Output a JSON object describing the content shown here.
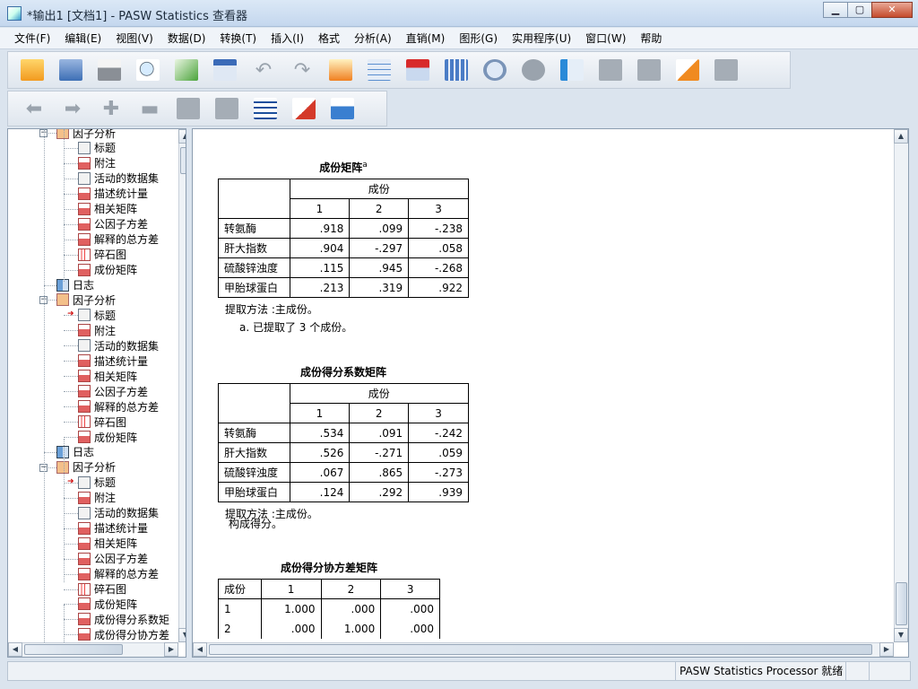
{
  "window": {
    "title": "*输出1 [文档1] - PASW Statistics 查看器",
    "minimize_label": "▁",
    "maximize_label": "▢",
    "close_label": "✕"
  },
  "menu": [
    "文件(F)",
    "编辑(E)",
    "视图(V)",
    "数据(D)",
    "转换(T)",
    "插入(I)",
    "格式",
    "分析(A)",
    "直销(M)",
    "图形(G)",
    "实用程序(U)",
    "窗口(W)",
    "帮助"
  ],
  "outline": {
    "nodes": [
      {
        "label": "因子分析",
        "indent": 1,
        "icon": "folder"
      },
      {
        "label": "标题",
        "indent": 2,
        "icon": "doc"
      },
      {
        "label": "附注",
        "indent": 2,
        "icon": "red"
      },
      {
        "label": "活动的数据集",
        "indent": 2,
        "icon": "doc"
      },
      {
        "label": "描述统计量",
        "indent": 2,
        "icon": "red"
      },
      {
        "label": "相关矩阵",
        "indent": 2,
        "icon": "red"
      },
      {
        "label": "公因子方差",
        "indent": 2,
        "icon": "red"
      },
      {
        "label": "解释的总方差",
        "indent": 2,
        "icon": "red"
      },
      {
        "label": "碎石图",
        "indent": 2,
        "icon": "chart"
      },
      {
        "label": "成份矩阵",
        "indent": 2,
        "icon": "red"
      },
      {
        "label": "日志",
        "indent": 1,
        "icon": "book"
      },
      {
        "label": "因子分析",
        "indent": 1,
        "icon": "folder"
      },
      {
        "label": "标题",
        "indent": 2,
        "icon": "doc",
        "arrow": true
      },
      {
        "label": "附注",
        "indent": 2,
        "icon": "red"
      },
      {
        "label": "活动的数据集",
        "indent": 2,
        "icon": "doc"
      },
      {
        "label": "描述统计量",
        "indent": 2,
        "icon": "red"
      },
      {
        "label": "相关矩阵",
        "indent": 2,
        "icon": "red"
      },
      {
        "label": "公因子方差",
        "indent": 2,
        "icon": "red"
      },
      {
        "label": "解释的总方差",
        "indent": 2,
        "icon": "red"
      },
      {
        "label": "碎石图",
        "indent": 2,
        "icon": "chart"
      },
      {
        "label": "成份矩阵",
        "indent": 2,
        "icon": "red"
      },
      {
        "label": "日志",
        "indent": 1,
        "icon": "book"
      },
      {
        "label": "因子分析",
        "indent": 1,
        "icon": "folder"
      },
      {
        "label": "标题",
        "indent": 2,
        "icon": "doc",
        "arrow": true
      },
      {
        "label": "附注",
        "indent": 2,
        "icon": "red"
      },
      {
        "label": "活动的数据集",
        "indent": 2,
        "icon": "doc"
      },
      {
        "label": "描述统计量",
        "indent": 2,
        "icon": "red"
      },
      {
        "label": "相关矩阵",
        "indent": 2,
        "icon": "red"
      },
      {
        "label": "公因子方差",
        "indent": 2,
        "icon": "red"
      },
      {
        "label": "解释的总方差",
        "indent": 2,
        "icon": "red"
      },
      {
        "label": "碎石图",
        "indent": 2,
        "icon": "chart"
      },
      {
        "label": "成份矩阵",
        "indent": 2,
        "icon": "red"
      },
      {
        "label": "成份得分系数矩",
        "indent": 2,
        "icon": "red"
      },
      {
        "label": "成份得分协方差",
        "indent": 2,
        "icon": "red"
      }
    ]
  },
  "component_matrix": {
    "title": "成份矩阵",
    "superscript": "a",
    "group_header": "成份",
    "columns": [
      "1",
      "2",
      "3"
    ],
    "rows": [
      {
        "label": "转氨酶",
        "values": [
          ".918",
          ".099",
          "-.238"
        ]
      },
      {
        "label": "肝大指数",
        "values": [
          ".904",
          "-.297",
          ".058"
        ]
      },
      {
        "label": "硫酸锌浊度",
        "values": [
          ".115",
          ".945",
          "-.268"
        ]
      },
      {
        "label": "甲胎球蛋白",
        "values": [
          ".213",
          ".319",
          ".922"
        ]
      }
    ],
    "note1": "提取方法 :主成份。",
    "note2": "a. 已提取了 3 个成份。"
  },
  "score_coef_matrix": {
    "title": "成份得分系数矩阵",
    "group_header": "成份",
    "columns": [
      "1",
      "2",
      "3"
    ],
    "rows": [
      {
        "label": "转氨酶",
        "values": [
          ".534",
          ".091",
          "-.242"
        ]
      },
      {
        "label": "肝大指数",
        "values": [
          ".526",
          "-.271",
          ".059"
        ]
      },
      {
        "label": "硫酸锌浊度",
        "values": [
          ".067",
          ".865",
          "-.273"
        ]
      },
      {
        "label": "甲胎球蛋白",
        "values": [
          ".124",
          ".292",
          ".939"
        ]
      }
    ],
    "note1": "提取方法 :主成份。",
    "note2": "构成得分。"
  },
  "score_cov_matrix": {
    "title": "成份得分协方差矩阵",
    "corner": "成份",
    "columns": [
      "1",
      "2",
      "3"
    ],
    "rows": [
      {
        "label": "1",
        "values": [
          "1.000",
          ".000",
          ".000"
        ]
      },
      {
        "label": "2",
        "values": [
          ".000",
          "1.000",
          ".000"
        ]
      }
    ]
  },
  "status": {
    "processor": "PASW Statistics Processor 就绪"
  }
}
